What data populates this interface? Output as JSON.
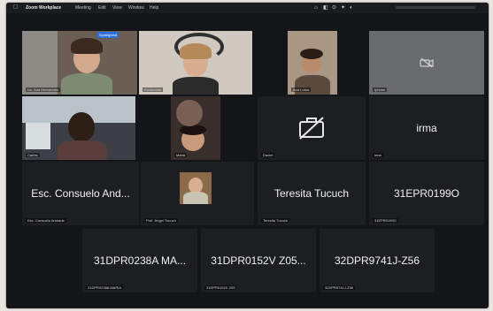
{
  "menubar": {
    "app_name": "Zoom Workplace",
    "menus": [
      "Meeting",
      "Edit",
      "View",
      "Window",
      "Help"
    ],
    "status": [
      "⌂",
      "◧",
      "⊙",
      "✦",
      "◐"
    ]
  },
  "badge": "Spotlighted",
  "tiles": {
    "t1": {
      "name": "Lic. Ana Hernández"
    },
    "t2": {
      "name": "Esmeralda"
    },
    "t3": {
      "name": "Ana Luisa"
    },
    "t4": {
      "name": "Iphone"
    },
    "t5": {
      "name": "Carlos"
    },
    "t6": {
      "name": "Maria"
    },
    "t7": {
      "name": "Daniel"
    },
    "t8": {
      "label": "irma",
      "name": "irma"
    },
    "t9": {
      "label": "Esc. Consuelo And...",
      "name": "Esc. Consuelo Andrade"
    },
    "t10": {
      "name": "Prof. Ángel Tucuch"
    },
    "t11": {
      "label": "Teresita Tucuch",
      "name": "Teresita Tucuch"
    },
    "t12": {
      "label": "31EPR0199O",
      "name": "31EPR0199O"
    },
    "t13": {
      "label": "31DPR0238A MA...",
      "name": "31DPR0238A MARIA"
    },
    "t14": {
      "label": "31DPR0152V Z05...",
      "name": "31DPR0152V Z05"
    },
    "t15": {
      "label": "32DPR9741J-Z56",
      "name": "32DPR9741J-Z56"
    }
  }
}
